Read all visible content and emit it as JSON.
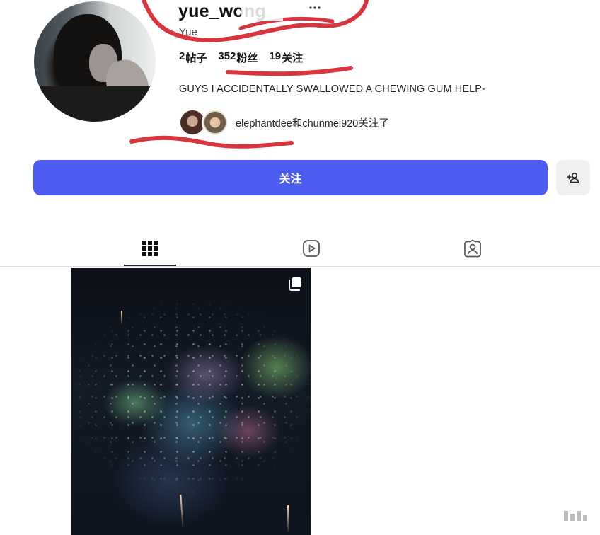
{
  "profile": {
    "username": "yue_wong",
    "display_name": "Yue",
    "stats": {
      "posts": {
        "value": "2",
        "label": "帖子"
      },
      "followers": {
        "value": "352",
        "label": "粉丝"
      },
      "following": {
        "value": "19",
        "label": "关注"
      }
    },
    "bio": "GUYS I ACCIDENTALLY SWALLOWED A CHEWING GUM HELP-",
    "followed_by_text": "elephantdee和chunmei920关注了"
  },
  "actions": {
    "follow_label": "关注"
  },
  "icons": {
    "more": "more-horizontal-icon",
    "add_user": "add-user-icon",
    "grid_tab": "grid-icon",
    "reels_tab": "reels-icon",
    "tagged_tab": "tagged-user-icon",
    "multi_post": "multiple-posts-icon"
  },
  "colors": {
    "accent": "#4c5bf0",
    "annotation": "#d8353e",
    "divider": "#dbdbdb"
  }
}
